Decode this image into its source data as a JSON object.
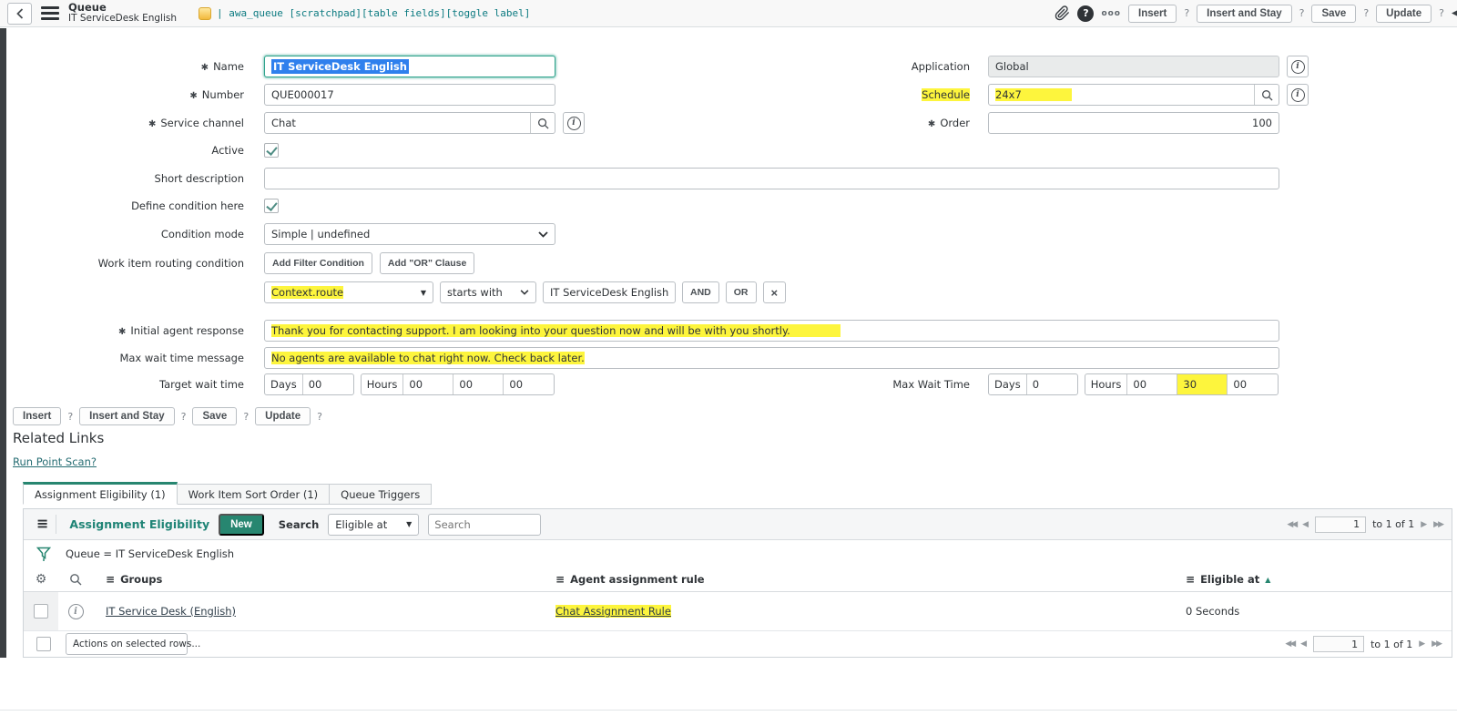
{
  "colors": {
    "accent_teal": "#278670",
    "highlight_yellow": "#fdf53d",
    "selection_blue": "#2f80ed"
  },
  "header": {
    "title": "Queue",
    "subtitle": "IT ServiceDesk English",
    "debug": "| awa_queue [scratchpad][table fields][toggle label]",
    "more": "ooo",
    "help": "?",
    "buttons": {
      "insert": "Insert",
      "insert_stay": "Insert and Stay",
      "save": "Save",
      "update": "Update"
    }
  },
  "form": {
    "name": {
      "label": "Name",
      "value": "IT ServiceDesk English"
    },
    "number": {
      "label": "Number",
      "value": "QUE000017"
    },
    "service_channel": {
      "label": "Service channel",
      "value": "Chat"
    },
    "active": {
      "label": "Active"
    },
    "short_description": {
      "label": "Short description",
      "value": ""
    },
    "define_condition": {
      "label": "Define condition here"
    },
    "condition_mode": {
      "label": "Condition mode",
      "value": "Simple | undefined"
    },
    "routing_condition": {
      "label": "Work item routing condition",
      "add_filter": "Add Filter Condition",
      "add_or": "Add \"OR\" Clause"
    },
    "condition_row": {
      "field": "Context.route",
      "operator": "starts with",
      "value": "IT ServiceDesk English",
      "and": "AND",
      "or": "OR",
      "remove": "×"
    },
    "initial_agent_response": {
      "label": "Initial agent response",
      "value": "Thank you for contacting support. I am looking into your question now and will be with you shortly."
    },
    "max_wait_message": {
      "label": "Max wait time message",
      "value": "No agents are available to chat right now. Check back later."
    },
    "target_wait": {
      "label": "Target wait time",
      "days_label": "Days",
      "days": "00",
      "hours_label": "Hours",
      "hours": "00",
      "minutes": "00",
      "seconds": "00"
    },
    "application": {
      "label": "Application",
      "value": "Global"
    },
    "schedule": {
      "label": "Schedule",
      "value": "24x7"
    },
    "order": {
      "label": "Order",
      "value": "100"
    },
    "max_wait": {
      "label": "Max Wait Time",
      "days_label": "Days",
      "days": "0",
      "hours_label": "Hours",
      "hours": "00",
      "minutes": "30",
      "seconds": "00"
    }
  },
  "related_links": {
    "heading": "Related Links",
    "link": "Run Point Scan?"
  },
  "tabs": [
    {
      "label": "Assignment Eligibility (1)"
    },
    {
      "label": "Work Item Sort Order (1)"
    },
    {
      "label": "Queue Triggers"
    }
  ],
  "list": {
    "title": "Assignment Eligibility",
    "new_button": "New",
    "search_label": "Search",
    "search_column": "Eligible at",
    "search_placeholder": "Search",
    "filter": "Queue = IT ServiceDesk English",
    "columns": [
      "Groups",
      "Agent assignment rule",
      "Eligible at"
    ],
    "rows": [
      {
        "group": "IT Service Desk (English)",
        "rule": "Chat Assignment Rule",
        "eligible": "0 Seconds"
      }
    ],
    "actions_select": "Actions on selected rows...",
    "pagination": {
      "page": "1",
      "range": "to 1 of 1"
    }
  }
}
